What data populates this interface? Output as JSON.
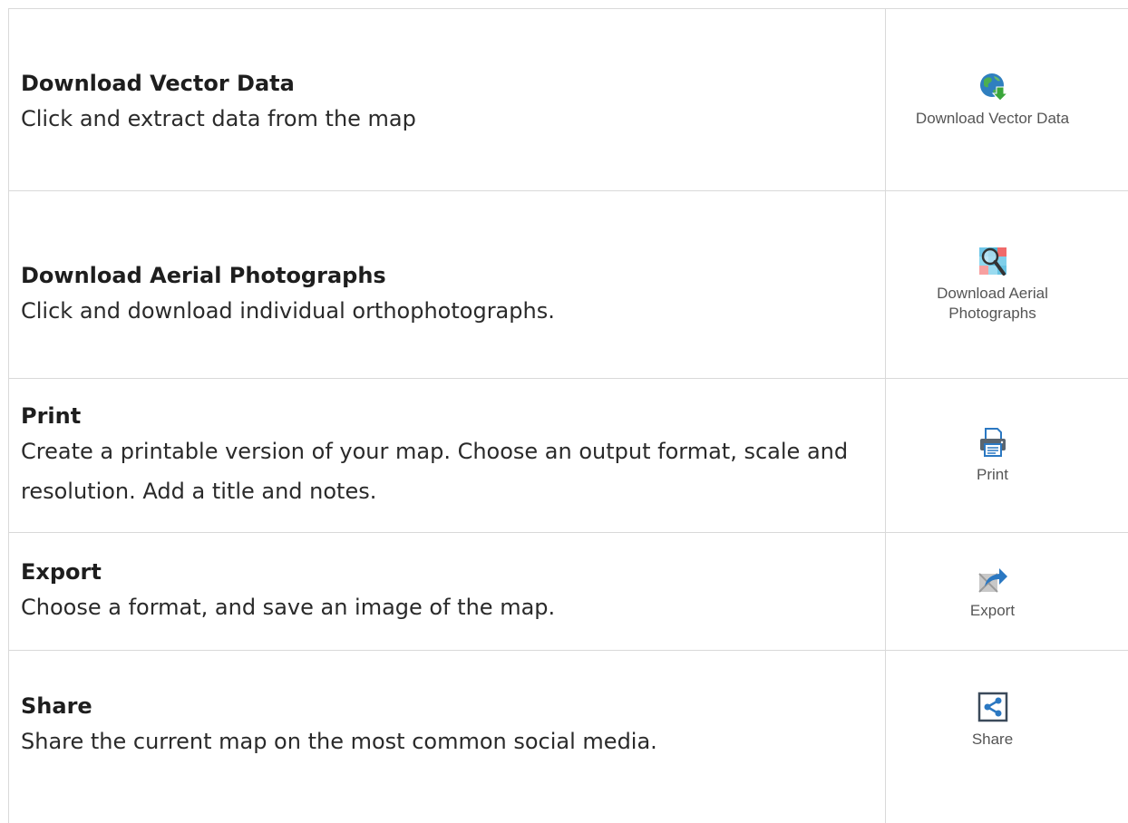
{
  "tools": [
    {
      "id": "vector",
      "title": "Download Vector Data",
      "description": "Click and extract data from the map",
      "button_label": "Download Vector Data",
      "icon": "globe-download-icon"
    },
    {
      "id": "aerial",
      "title": "Download Aerial Photographs",
      "description": "Click and download individual orthophotographs.",
      "button_label": "Download Aerial Photographs",
      "icon": "aerial-magnifier-icon"
    },
    {
      "id": "print",
      "title": "Print",
      "description": "Create a printable version of your map. Choose an output format, scale and resolution. Add a title and notes.",
      "button_label": "Print",
      "icon": "printer-icon"
    },
    {
      "id": "export",
      "title": "Export",
      "description": "Choose a format, and save an image of the map.",
      "button_label": "Export",
      "icon": "export-arrow-icon"
    },
    {
      "id": "share",
      "title": "Share",
      "description": "Share the current map on the most common social media.",
      "button_label": "Share",
      "icon": "share-icon"
    }
  ],
  "colors": {
    "border": "#d9d9d9",
    "title_text": "#1e1e1e",
    "body_text": "#2a2a2a",
    "icon_label": "#555555",
    "icon_blue": "#2b78c2"
  }
}
